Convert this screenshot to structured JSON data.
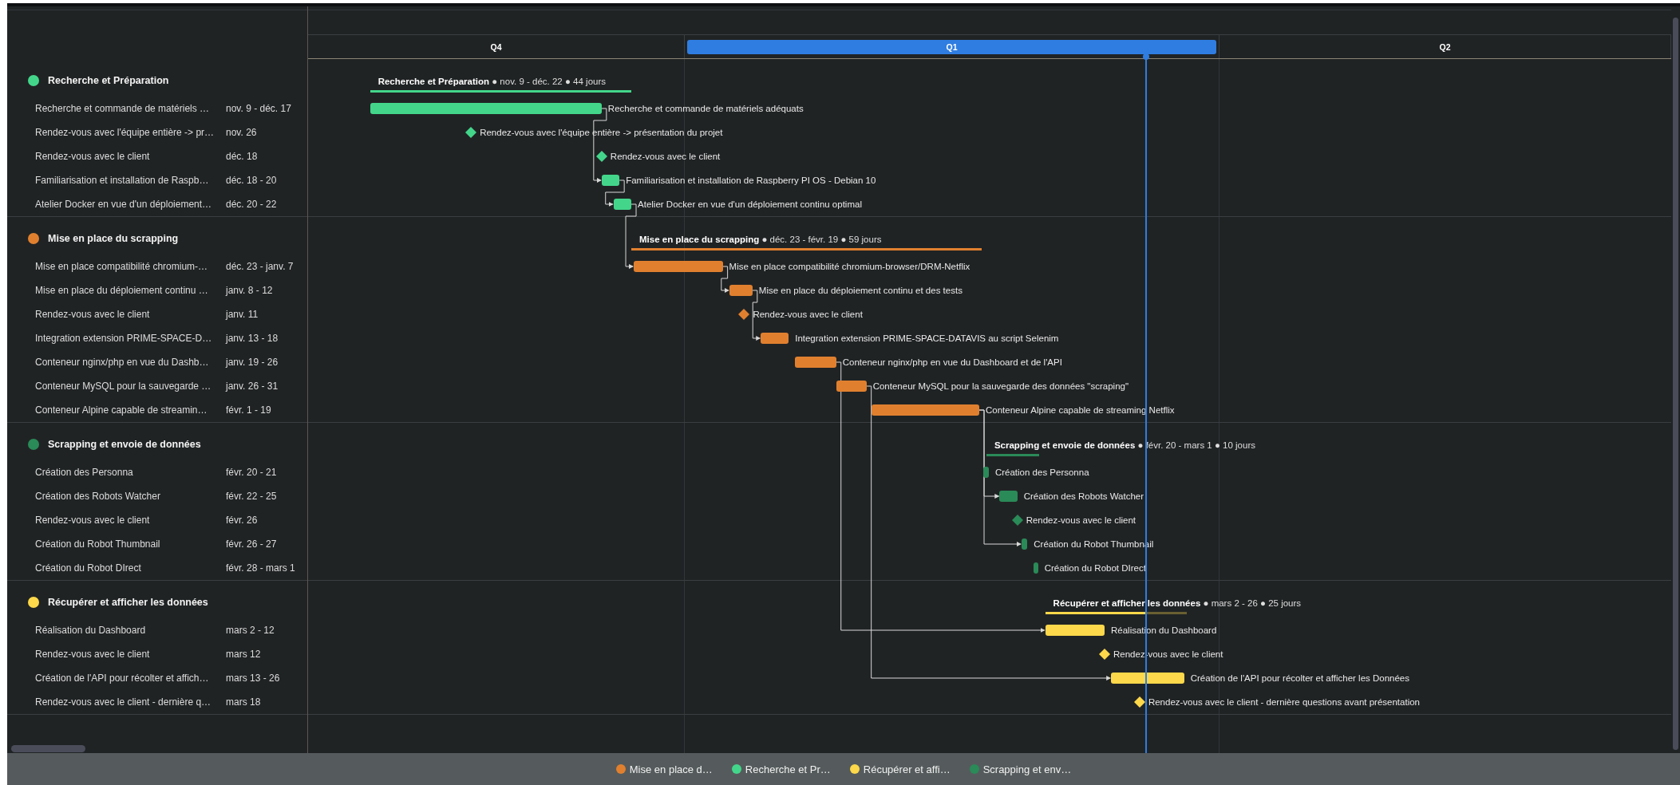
{
  "quarters": [
    {
      "label": "Q4",
      "current": false
    },
    {
      "label": "Q1",
      "current": true
    },
    {
      "label": "Q2",
      "current": false
    }
  ],
  "groups": [
    {
      "name": "Recherche et Préparation",
      "color": "#43d68b",
      "summary": "**Recherche et Préparation** ● nov. 9 - déc. 22 ● 44 jours",
      "tasks": [
        {
          "kind": "bar",
          "name": "Recherche et commande de matériels …",
          "dates": "nov. 9 - déc. 17",
          "label": "Recherche et commande de matériels adéquats"
        },
        {
          "kind": "milestone",
          "name": "Rendez-vous avec l'équipe entière -> pr…",
          "dates": "nov. 26",
          "label": "Rendez-vous avec l'équipe entière -> présentation du projet"
        },
        {
          "kind": "milestone",
          "name": "Rendez-vous avec le client",
          "dates": "déc. 18",
          "label": "Rendez-vous avec le client"
        },
        {
          "kind": "bar",
          "name": "Familiarisation et installation de Raspb…",
          "dates": "déc. 18 - 20",
          "label": "Familiarisation et installation de Raspberry PI OS - Debian 10"
        },
        {
          "kind": "bar",
          "name": "Atelier Docker en vue d'un déploiement…",
          "dates": "déc. 20 - 22",
          "label": "Atelier Docker en vue d'un déploiement continu optimal"
        }
      ]
    },
    {
      "name": "Mise en place du scrapping",
      "color": "#e0802f",
      "summary": "**Mise en place du scrapping** ● déc. 23 - févr. 19 ● 59 jours",
      "tasks": [
        {
          "kind": "bar",
          "name": "Mise en place compatibilité chromium-…",
          "dates": "déc. 23 - janv. 7",
          "label": "Mise en place compatibilité chromium-browser/DRM-Netflix"
        },
        {
          "kind": "bar",
          "name": "Mise en place du déploiement continu …",
          "dates": "janv. 8 - 12",
          "label": "Mise en place du déploiement continu et des tests"
        },
        {
          "kind": "milestone",
          "name": "Rendez-vous avec le client",
          "dates": "janv. 11",
          "label": "Rendez-vous avec le client"
        },
        {
          "kind": "bar",
          "name": "Integration extension PRIME-SPACE-D…",
          "dates": "janv. 13 - 18",
          "label": "Integration extension PRIME-SPACE-DATAVIS au script Selenim"
        },
        {
          "kind": "bar",
          "name": "Conteneur nginx/php en vue du Dashb…",
          "dates": "janv. 19 - 26",
          "label": "Conteneur nginx/php en vue du Dashboard et de l'API"
        },
        {
          "kind": "bar",
          "name": "Conteneur MySQL pour la sauvegarde …",
          "dates": "janv. 26 - 31",
          "label": "Conteneur MySQL pour la sauvegarde des données \"scraping\""
        },
        {
          "kind": "bar",
          "name": "Conteneur Alpine capable de streamin…",
          "dates": "févr. 1 - 19",
          "label": "Conteneur Alpine capable de streaming Netflix"
        }
      ]
    },
    {
      "name": "Scrapping et envoie de données",
      "color": "#2a8a58",
      "summary": "**Scrapping et envoie de données** ● févr. 20 - mars 1 ● 10 jours",
      "tasks": [
        {
          "kind": "bar",
          "name": "Création des Personna",
          "dates": "févr. 20 - 21",
          "label": "Création des Personna"
        },
        {
          "kind": "bar",
          "name": "Création des Robots Watcher",
          "dates": "févr. 22 - 25",
          "label": "Création des Robots Watcher"
        },
        {
          "kind": "milestone",
          "name": "Rendez-vous avec le client",
          "dates": "févr. 26",
          "label": "Rendez-vous avec le client"
        },
        {
          "kind": "bar",
          "name": "Création du Robot Thumbnail",
          "dates": "févr. 26 - 27",
          "label": "Création du Robot Thumbnail"
        },
        {
          "kind": "bar",
          "name": "Création du Robot DIrect",
          "dates": "févr. 28 - mars 1",
          "label": "Création du Robot DIrect"
        }
      ]
    },
    {
      "name": "Récupérer et afficher les données",
      "color": "#fcd84a",
      "summary": "**Récupérer et afficher les données** ● mars 2 - 26 ● 25 jours",
      "tasks": [
        {
          "kind": "bar",
          "name": "Réalisation du Dashboard",
          "dates": "mars 2 - 12",
          "label": "Réalisation du Dashboard"
        },
        {
          "kind": "milestone",
          "name": "Rendez-vous avec le client",
          "dates": "mars 12",
          "label": "Rendez-vous avec le client"
        },
        {
          "kind": "bar",
          "name": "Création de l'API pour récolter et affich…",
          "dates": "mars 13 - 26",
          "label": "Création de l'API pour récolter et afficher les Données"
        },
        {
          "kind": "milestone",
          "name": "Rendez-vous avec le client - dernière q…",
          "dates": "mars 18",
          "label": "Rendez-vous avec le client - dernière questions avant présentation"
        }
      ]
    }
  ],
  "legend": [
    {
      "label": "Mise en place d…",
      "color": "#e0802f"
    },
    {
      "label": "Recherche et Pr…",
      "color": "#43d68b"
    },
    {
      "label": "Récupérer et affi…",
      "color": "#fcd84a"
    },
    {
      "label": "Scrapping et env…",
      "color": "#2a8a58"
    }
  ]
}
